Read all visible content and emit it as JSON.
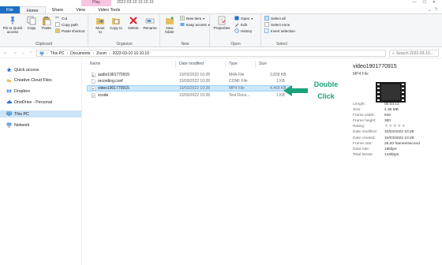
{
  "titlebar": {
    "context_tab": "Play",
    "title": "2022-03-10 10.10.10",
    "controls": [
      "—",
      "☐",
      "✕"
    ]
  },
  "ribbon_tabs": {
    "items": [
      "File",
      "Home",
      "Share",
      "View",
      "Video Tools"
    ],
    "active": "Home",
    "right_icons": [
      "chevron-icon",
      "help-icon"
    ]
  },
  "ribbon": {
    "clipboard": {
      "label": "Clipboard",
      "pin": "Pin to Quick access",
      "copy": "Copy",
      "paste": "Paste",
      "cut": "Cut",
      "copy_path": "Copy path",
      "paste_shortcut": "Paste shortcut"
    },
    "organize": {
      "label": "Organize",
      "move_to": "Move to",
      "copy_to": "Copy to",
      "delete": "Delete",
      "rename": "Rename"
    },
    "new": {
      "label": "New",
      "new_folder": "New folder",
      "new_item": "New item",
      "easy_access": "Easy access"
    },
    "open": {
      "label": "Open",
      "properties": "Properties",
      "open": "Open",
      "edit": "Edit",
      "history": "History"
    },
    "select": {
      "label": "Select",
      "select_all": "Select all",
      "select_none": "Select none",
      "invert": "Invert selection"
    }
  },
  "address": {
    "crumbs": [
      "This PC",
      "Documents",
      "Zoom",
      "2022-03-10 10.10.10"
    ],
    "search_placeholder": "Search 2022-03-10..."
  },
  "nav": {
    "items": [
      {
        "label": "Quick access",
        "icon": "star-icon"
      },
      {
        "label": "Creative Cloud Files",
        "icon": "creative-cloud-icon"
      },
      {
        "label": "Dropbox",
        "icon": "dropbox-icon"
      },
      {
        "label": "OneDrive - Personal",
        "icon": "onedrive-icon"
      },
      {
        "label": "This PC",
        "icon": "computer-icon"
      },
      {
        "label": "Network",
        "icon": "network-icon"
      }
    ],
    "selected": "This PC"
  },
  "files": {
    "columns": [
      "Name",
      "Date modified",
      "Type",
      "Size"
    ],
    "rows": [
      {
        "name": "audio1901770915",
        "date": "10/03/2022 10:28",
        "type": "M4A File",
        "size": "3,839 KB"
      },
      {
        "name": "recording.conf",
        "date": "10/03/2022 10:28",
        "type": "CONF File",
        "size": "1 KB"
      },
      {
        "name": "video1901770915",
        "date": "10/03/2022 10:28",
        "type": "MP4 File",
        "size": "4,469 KB"
      },
      {
        "name": "xcode",
        "date": "10/03/2022 10:28",
        "type": "Text Docu...",
        "size": "1 KB"
      }
    ],
    "selected_index": 2
  },
  "annotation": {
    "line1": "Double",
    "line2": "Click",
    "color": "#1aa37a"
  },
  "details": {
    "title": "video1901770915",
    "type": "MP4 File",
    "props": [
      {
        "key": "Length:",
        "value": "00:04:13"
      },
      {
        "key": "Size:",
        "value": "4.36 MB"
      },
      {
        "key": "Frame width:",
        "value": "640"
      },
      {
        "key": "Frame height:",
        "value": "360"
      },
      {
        "key": "Rating:",
        "value": ""
      },
      {
        "key": "Date modified:",
        "value": "10/03/2022 10:28"
      },
      {
        "key": "Date created:",
        "value": "10/03/2022 10:28"
      },
      {
        "key": "Frame rate:",
        "value": "25.00 frames/second"
      },
      {
        "key": "Data rate:",
        "value": "16kbps"
      },
      {
        "key": "Total bitrate:",
        "value": "142kbps"
      }
    ],
    "rating_stars": 0
  },
  "colors": {
    "accent": "#1f6fc4",
    "selection": "#cce8ff",
    "nav_selection": "#cce4f7",
    "play_tab": "#f6c6e0"
  }
}
